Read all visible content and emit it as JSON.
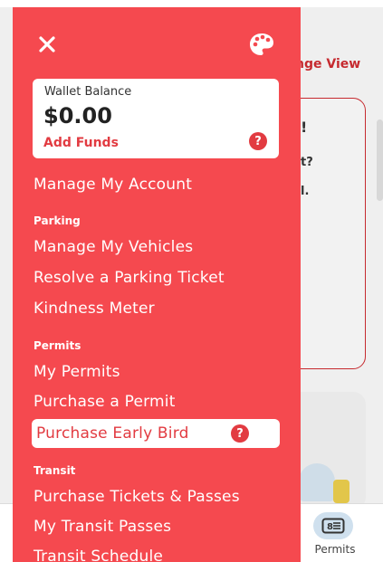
{
  "background": {
    "change_view": "nge View",
    "alert_fragments": [
      "!",
      "t?",
      "l."
    ],
    "bottom_tab": {
      "label": "Permits",
      "icon": "permit-card-icon"
    }
  },
  "drawer": {
    "close_icon": "close-icon",
    "theme_icon": "palette-icon",
    "wallet": {
      "label": "Wallet Balance",
      "amount": "$0.00",
      "action": "Add Funds",
      "help": "?"
    },
    "account_item": "Manage My Account",
    "sections": {
      "parking": {
        "title": "Parking",
        "items": [
          "Manage My Vehicles",
          "Resolve a Parking Ticket",
          "Kindness Meter"
        ]
      },
      "permits": {
        "title": "Permits",
        "items": [
          "My Permits",
          "Purchase a Permit",
          "Purchase Early Bird"
        ],
        "highlight_help": "?"
      },
      "transit": {
        "title": "Transit",
        "items": [
          "Purchase Tickets & Passes",
          "My Transit Passes",
          "Transit Schedule"
        ]
      }
    }
  },
  "colors": {
    "drawer_bg": "#f5494f",
    "accent_red": "#e23b41",
    "brand_dark_red": "#c62a2f"
  }
}
